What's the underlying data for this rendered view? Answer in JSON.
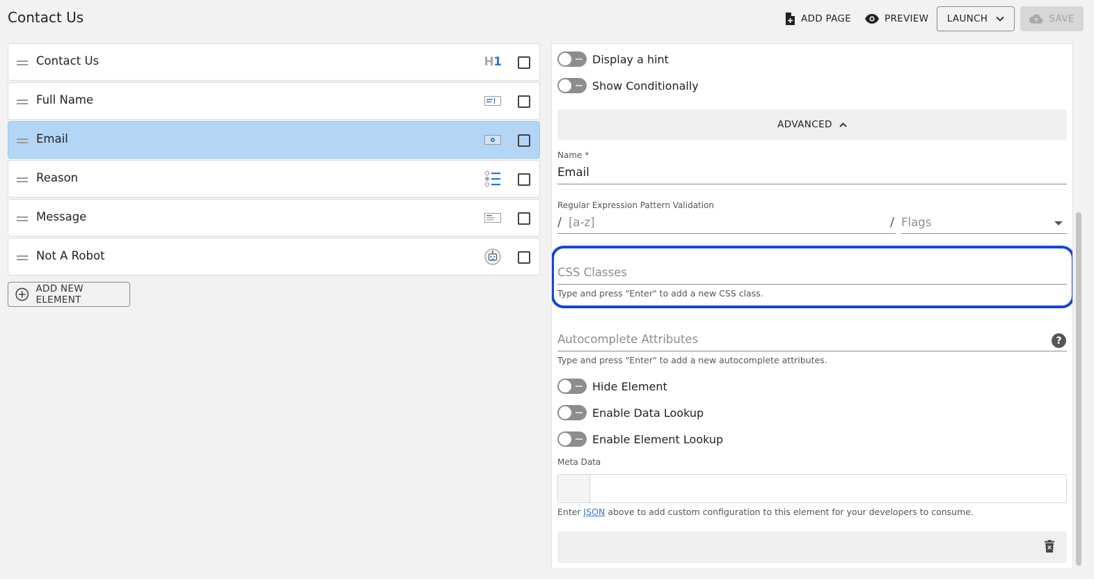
{
  "header": {
    "title": "Contact Us",
    "add_page_label": "ADD PAGE",
    "preview_label": "PREVIEW",
    "launch_label": "LAUNCH",
    "save_label": "SAVE"
  },
  "elements": [
    {
      "label": "Contact Us",
      "icon": "heading-h1-icon",
      "icon_text_h": "H",
      "icon_text_n": "1",
      "selected": false
    },
    {
      "label": "Full Name",
      "icon": "text-field-icon",
      "selected": false
    },
    {
      "label": "Email",
      "icon": "email-field-icon",
      "selected": true
    },
    {
      "label": "Reason",
      "icon": "radio-list-icon",
      "selected": false
    },
    {
      "label": "Message",
      "icon": "textarea-icon",
      "selected": false
    },
    {
      "label": "Not A Robot",
      "icon": "robot-icon",
      "selected": false
    }
  ],
  "add_element_label": "ADD NEW ELEMENT",
  "settings": {
    "toggles_top": [
      {
        "label": "Display a hint",
        "on": false
      },
      {
        "label": "Show Conditionally",
        "on": false
      }
    ],
    "advanced_label": "ADVANCED",
    "name_label": "Name *",
    "name_value": "Email",
    "regex_label": "Regular Expression Pattern Validation",
    "regex_slash": "/",
    "regex_placeholder": "[a-z]",
    "flags_slash": "/",
    "flags_placeholder": "Flags",
    "css_placeholder": "CSS Classes",
    "css_helper": "Type and press \"Enter\" to add a new CSS class.",
    "autocomplete_placeholder": "Autocomplete Attributes",
    "autocomplete_helper": "Type and press \"Enter\" to add a new autocomplete attributes.",
    "help_glyph": "?",
    "toggles_bottom": [
      {
        "label": "Hide Element",
        "on": false
      },
      {
        "label": "Enable Data Lookup",
        "on": false
      },
      {
        "label": "Enable Element Lookup",
        "on": false
      }
    ],
    "meta_label": "Meta Data",
    "meta_helper_pre": "Enter ",
    "meta_helper_link": "JSON",
    "meta_helper_post": " above to add custom configuration to this element for your developers to consume."
  },
  "colors": {
    "accent": "#2878d0",
    "selected_row": "#b3d6f7",
    "highlight": "#1546d8"
  }
}
